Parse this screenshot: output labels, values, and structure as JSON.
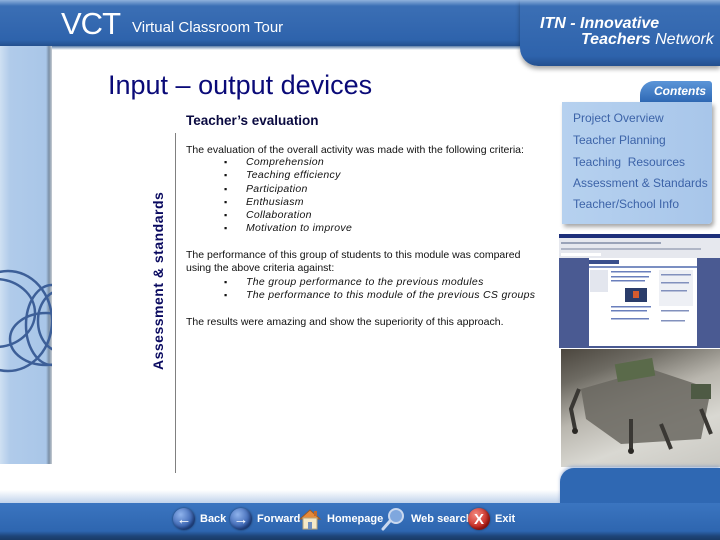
{
  "header": {
    "logo": "VCT",
    "subtitle": "Virtual Classroom Tour",
    "network_line1": "ITN - Innovative",
    "network_line2_bold": "Teachers",
    "network_line2_rest": " Network"
  },
  "page": {
    "title": "Input – output devices",
    "side_label": "Assessment & standards",
    "section_title": "Teacher’s evaluation",
    "intro": "The evaluation of the overall activity was made with the following criteria:",
    "criteria": [
      "Comprehension",
      "Teaching efficiency",
      "Participation",
      "Enthusiasm",
      "Collaboration",
      "Motivation to improve"
    ],
    "comparison_intro": "The performance of this group of students to this module was compared using the above criteria against:",
    "comparisons": [
      "The group performance to the previous modules",
      "The performance to this module of the previous CS groups"
    ],
    "conclusion": "The results were amazing and show the superiority of this approach."
  },
  "contents": {
    "tab_label": "Contents",
    "items": [
      "Project Overview",
      "Teacher Planning",
      "Teaching  Resources",
      "Assessment & Standards",
      "Teacher/School Info"
    ]
  },
  "nav": {
    "back": "Back",
    "forward": "Forward",
    "homepage": "Homepage",
    "web_search": "Web search",
    "exit": "Exit"
  },
  "bullet_glyph": "▪",
  "colors": {
    "bar_blue": "#2e63ac",
    "title_navy": "#0a0a78",
    "contents_text": "#3c63a8",
    "contents_panel": "#b6d1ef",
    "exit_red": "#c21d16"
  }
}
